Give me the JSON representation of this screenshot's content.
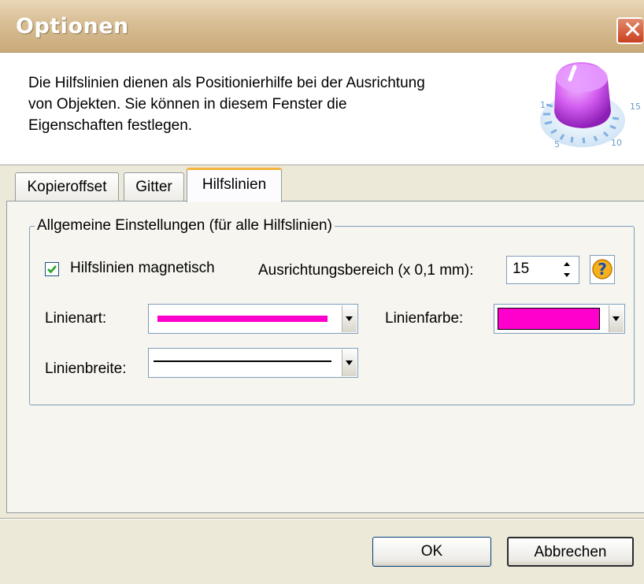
{
  "window": {
    "title": "Optionen"
  },
  "header": {
    "description_lines": [
      "Die Hilfslinien dienen als Positionierhilfe bei der Ausrichtung",
      "von Objekten. Sie können in diesem Fenster die",
      "Eigenschaften festlegen."
    ],
    "dial_ticks": {
      "t1": "1",
      "t5": "5",
      "t10": "10",
      "t15": "15"
    }
  },
  "tabs": [
    {
      "label": "Kopieroffset",
      "active": false
    },
    {
      "label": "Gitter",
      "active": false
    },
    {
      "label": "Hilfslinien",
      "active": true
    }
  ],
  "group": {
    "legend": "Allgemeine Einstellungen (für alle Hilfslinien)",
    "magnetic_checkbox": {
      "label": "Hilfslinien magnetisch",
      "checked": true
    },
    "alignment_range": {
      "label": "Ausrichtungsbereich (x 0,1 mm):",
      "value": "15"
    },
    "line_style": {
      "label": "Linienart:",
      "sample_color": "#ff00cc"
    },
    "line_color": {
      "label": "Linienfarbe:",
      "color": "#ff00cc"
    },
    "line_width": {
      "label": "Linienbreite:",
      "sample_color": "#000000"
    }
  },
  "buttons": {
    "ok": "OK",
    "cancel": "Abbrechen"
  },
  "icons": {
    "close": "close-icon",
    "help": "help-icon",
    "dial": "dial-icon"
  }
}
